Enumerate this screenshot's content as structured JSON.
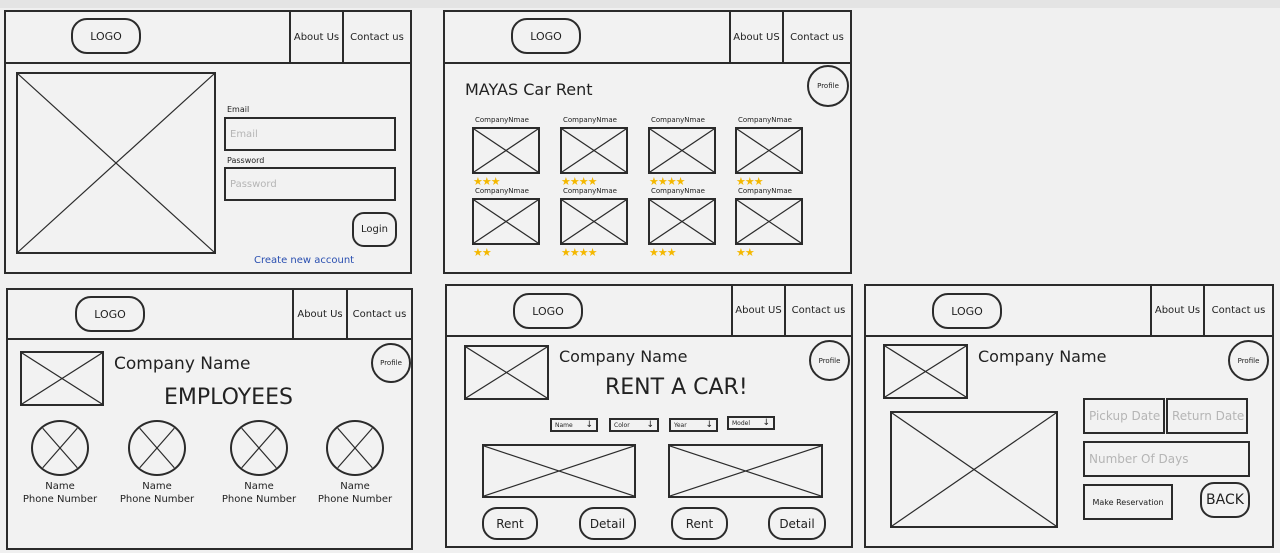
{
  "common": {
    "logo": "LOGO",
    "about_us_a": "About US",
    "about_us_b": "About Us",
    "contact": "Contact us",
    "profile": "Profile"
  },
  "login": {
    "email_label": "Email",
    "email_placeholder": "Email",
    "password_label": "Password",
    "password_placeholder": "Password",
    "login_button": "Login",
    "create_account": "Create new account"
  },
  "catalog": {
    "title": "MAYAS Car Rent",
    "cards": [
      {
        "name": "CompanyNmae",
        "stars": "★★★",
        "rating": 3
      },
      {
        "name": "CompanyNmae",
        "stars": "★★★★",
        "rating": 4
      },
      {
        "name": "CompanyNmae",
        "stars": "★★★★",
        "rating": 4
      },
      {
        "name": "CompanyNmae",
        "stars": "★★★",
        "rating": 3
      },
      {
        "name": "CompanyNmae",
        "stars": "★★",
        "rating": 2
      },
      {
        "name": "CompanyNmae",
        "stars": "★★★★",
        "rating": 4
      },
      {
        "name": "CompanyNmae",
        "stars": "★★★",
        "rating": 3
      },
      {
        "name": "CompanyNmae",
        "stars": "★★",
        "rating": 2
      }
    ]
  },
  "employees": {
    "company_name": "Company Name",
    "heading": "EMPLOYEES",
    "people": [
      {
        "name": "Name",
        "phone": "Phone Number"
      },
      {
        "name": "Name",
        "phone": "Phone Number"
      },
      {
        "name": "Name",
        "phone": "Phone Number"
      },
      {
        "name": "Name",
        "phone": "Phone Number"
      }
    ]
  },
  "rent": {
    "company_name": "Company Name",
    "heading": "RENT A CAR!",
    "filters": [
      "Name",
      "Color",
      "Year",
      "Model"
    ],
    "rent_button": "Rent",
    "detail_button": "Detail"
  },
  "reservation": {
    "company_name": "Company Name",
    "pickup_placeholder": "Pickup Date",
    "return_placeholder": "Return Date",
    "days_placeholder": "Number Of Days",
    "make_reservation": "Make Reservation",
    "back": "BACK"
  },
  "colors": {
    "stroke": "#2b2b2b",
    "star": "#f4b800",
    "link": "#2a4fb0"
  }
}
